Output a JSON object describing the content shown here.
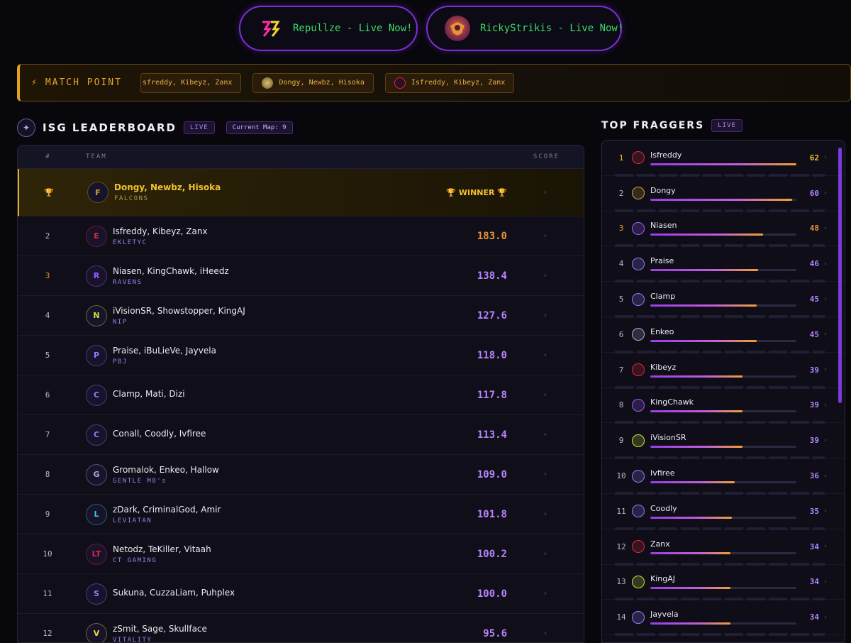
{
  "streams": [
    {
      "label": "Repullze - Live Now!",
      "icon": "repullze-logo-icon"
    },
    {
      "label": "RickyStrikis - Live Now!",
      "icon": "rickystrikis-avatar-icon"
    }
  ],
  "match_point": {
    "label": "MATCH POINT",
    "chips": [
      {
        "text": "sfreddy, Kibeyz, Zanx"
      },
      {
        "text": "Dongy, Newbz, Hisoka"
      },
      {
        "text": "Isfreddy, Kibeyz, Zanx"
      }
    ]
  },
  "leaderboard": {
    "title": "ISG LEADERBOARD",
    "live": "LIVE",
    "current_map": "Current Map: 9",
    "headers": {
      "rank": "#",
      "team": "TEAM",
      "score": "SCORE"
    },
    "winner_label": "🏆 WINNER 🏆",
    "rows": [
      {
        "rank": "🏆",
        "name": "Dongy, Newbz, Hisoka",
        "tag": "FALCONS",
        "score": "",
        "logo_color": "#c9a23a",
        "logo_text": "F"
      },
      {
        "rank": "2",
        "name": "Isfreddy, Kibeyz, Zanx",
        "tag": "EKLETYC",
        "score": "183.0",
        "logo_color": "#e0263c",
        "logo_text": "E"
      },
      {
        "rank": "3",
        "name": "Niasen, KingChawk, iHeedz",
        "tag": "RAVENS",
        "score": "138.4",
        "logo_color": "#9d5cff",
        "logo_text": "R"
      },
      {
        "rank": "4",
        "name": "iVisionSR, Showstopper, KingAJ",
        "tag": "NIP",
        "score": "127.6",
        "logo_color": "#c8e63a",
        "logo_text": "N"
      },
      {
        "rank": "5",
        "name": "Praise, iBuLieVe, Jayvela",
        "tag": "PBJ",
        "score": "118.0",
        "logo_color": "#8f7bff",
        "logo_text": "P"
      },
      {
        "rank": "6",
        "name": "Clamp, Mati, Dizi",
        "tag": "",
        "score": "117.8",
        "logo_color": "#8f7bff",
        "logo_text": "C"
      },
      {
        "rank": "7",
        "name": "Conall, Coodly, Ivfiree",
        "tag": "",
        "score": "113.4",
        "logo_color": "#8f7bff",
        "logo_text": "C"
      },
      {
        "rank": "8",
        "name": "Gromalok, Enkeo, Hallow",
        "tag": "GENTLE M8's",
        "score": "109.0",
        "logo_color": "#b9a4d8",
        "logo_text": "G"
      },
      {
        "rank": "9",
        "name": "zDark, CriminalGod, Amir",
        "tag": "LEVIATAN",
        "score": "101.8",
        "logo_color": "#3ac8e6",
        "logo_text": "L"
      },
      {
        "rank": "10",
        "name": "Netodz, TeKiller, Vitaah",
        "tag": "CT GAMING",
        "score": "100.2",
        "logo_color": "#e0263c",
        "logo_text": "LT"
      },
      {
        "rank": "11",
        "name": "Sukuna, CuzzaLiam, Puhplex",
        "tag": "",
        "score": "100.0",
        "logo_color": "#8f7bff",
        "logo_text": "S"
      },
      {
        "rank": "12",
        "name": "zSmit, Sage, Skullface",
        "tag": "VITALITY",
        "score": "95.6",
        "logo_color": "#f2d530",
        "logo_text": "V"
      }
    ]
  },
  "top_fraggers": {
    "title": "TOP FRAGGERS",
    "live": "LIVE",
    "max_kills": 62,
    "players": [
      {
        "rank": "1",
        "name": "Isfreddy",
        "kills": 62,
        "logo_color": "#e0263c"
      },
      {
        "rank": "2",
        "name": "Dongy",
        "kills": 60,
        "logo_color": "#c9a23a"
      },
      {
        "rank": "3",
        "name": "Niasen",
        "kills": 48,
        "logo_color": "#9d5cff"
      },
      {
        "rank": "4",
        "name": "Praise",
        "kills": 46,
        "logo_color": "#8f7bff"
      },
      {
        "rank": "5",
        "name": "Clamp",
        "kills": 45,
        "logo_color": "#8f7bff"
      },
      {
        "rank": "6",
        "name": "Enkeo",
        "kills": 45,
        "logo_color": "#b9a4d8"
      },
      {
        "rank": "7",
        "name": "Kibeyz",
        "kills": 39,
        "logo_color": "#e0263c"
      },
      {
        "rank": "8",
        "name": "KingChawk",
        "kills": 39,
        "logo_color": "#9d5cff"
      },
      {
        "rank": "9",
        "name": "iVisionSR",
        "kills": 39,
        "logo_color": "#c8e63a"
      },
      {
        "rank": "10",
        "name": "Ivfiree",
        "kills": 36,
        "logo_color": "#8f7bff"
      },
      {
        "rank": "11",
        "name": "Coodly",
        "kills": 35,
        "logo_color": "#8f7bff"
      },
      {
        "rank": "12",
        "name": "Zanx",
        "kills": 34,
        "logo_color": "#e0263c"
      },
      {
        "rank": "13",
        "name": "KingAJ",
        "kills": 34,
        "logo_color": "#c8e63a"
      },
      {
        "rank": "14",
        "name": "Jayvela",
        "kills": 34,
        "logo_color": "#8f7bff"
      }
    ]
  }
}
